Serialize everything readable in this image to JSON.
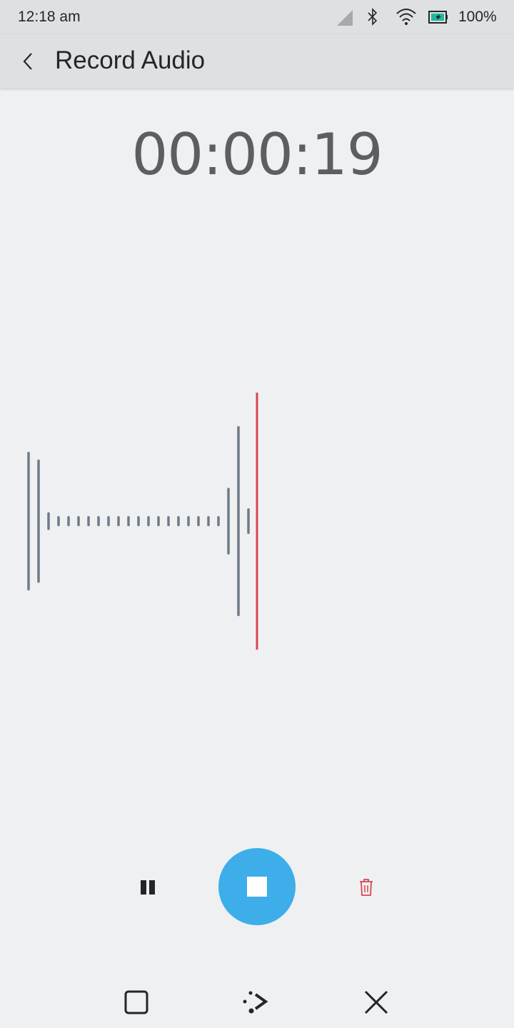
{
  "status_bar": {
    "time": "12:18 am",
    "battery": "100%",
    "icons": [
      "signal-icon",
      "bluetooth-icon",
      "wifi-icon",
      "battery-icon"
    ],
    "battery_accent": "#1abc9c"
  },
  "header": {
    "title": "Record Audio",
    "back_icon": "chevron-left-icon"
  },
  "recorder": {
    "elapsed": "00:00:19",
    "waveform_levels": [
      0.53,
      0.47,
      0.06,
      0.03,
      0.03,
      0.03,
      0.03,
      0.03,
      0.03,
      0.03,
      0.03,
      0.03,
      0.03,
      0.03,
      0.03,
      0.03,
      0.03,
      0.03,
      0.03,
      0.03,
      0.25,
      0.73,
      0.09
    ],
    "waveform_color": "#6e7a88",
    "playhead_color": "#da4453"
  },
  "controls": {
    "pause_icon": "pause-icon",
    "stop_icon": "stop-icon",
    "delete_icon": "trash-icon",
    "accent": "#3daee9",
    "danger": "#da4453"
  },
  "navigation": {
    "icons": [
      "overview-icon",
      "home-icon",
      "close-icon"
    ]
  }
}
